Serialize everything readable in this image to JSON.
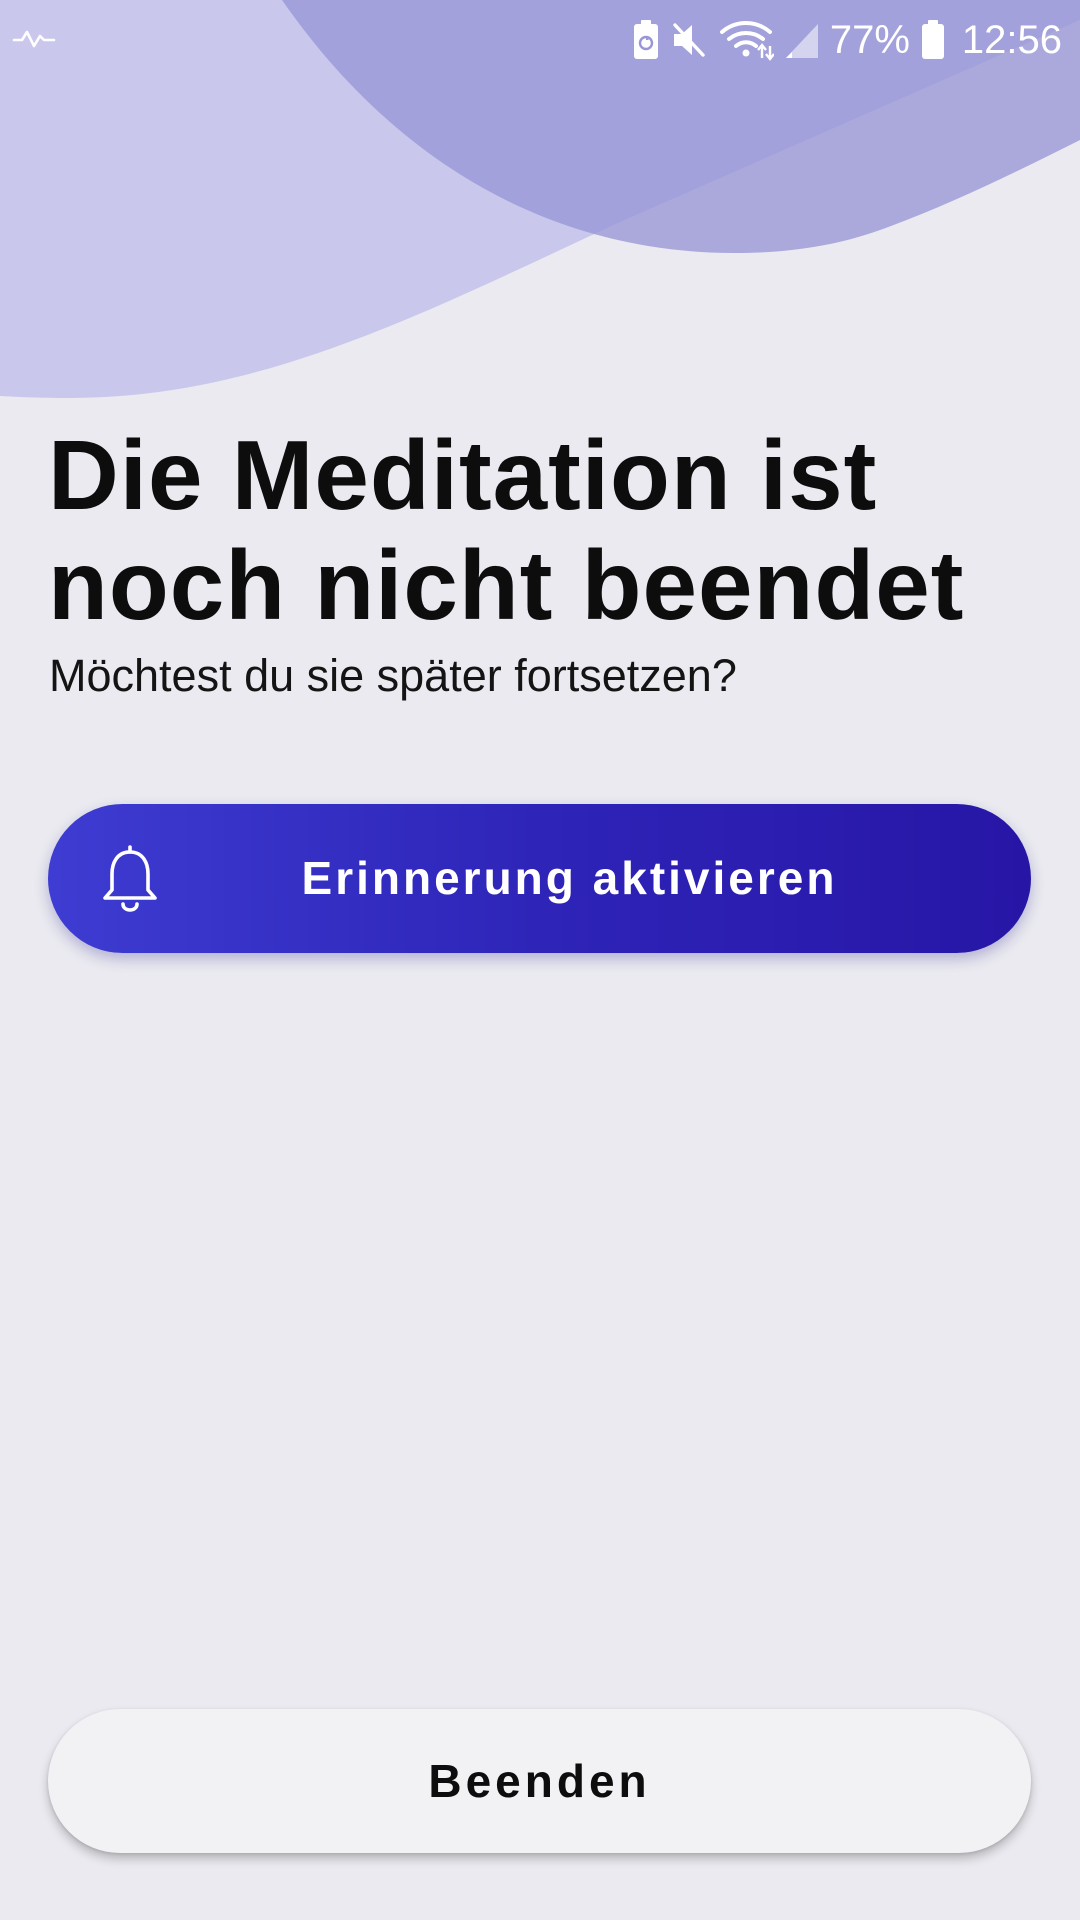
{
  "status_bar": {
    "battery_percent": "77%",
    "time": "12:56",
    "icons": [
      "pulse-icon",
      "battery-saver-icon",
      "mute-icon",
      "wifi-icon",
      "signal-icon",
      "battery-icon"
    ]
  },
  "content": {
    "title": "Die Meditation ist noch nicht beendet",
    "subtitle": "Möchtest du sie später fortsetzen?"
  },
  "actions": {
    "reminder_label": "Erinnerung aktivieren",
    "end_label": "Beenden"
  },
  "colors": {
    "background": "#EAEAF0",
    "wave_light": "#C9C8EC",
    "wave_dark": "#9896D6",
    "primary_gradient_start": "#3E3CD2",
    "primary_gradient_end": "#2716A6",
    "secondary_button": "#F2F2F4"
  }
}
